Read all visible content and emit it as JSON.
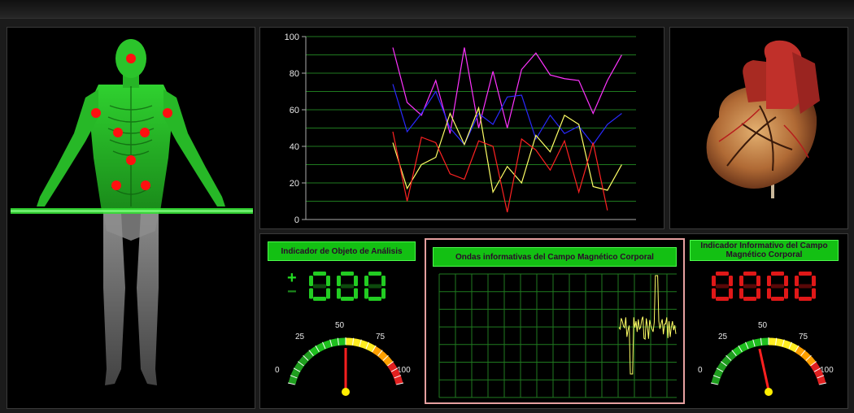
{
  "window": {
    "title_bar": ""
  },
  "chart_data": {
    "type": "line",
    "x": [
      1,
      2,
      3,
      4,
      5,
      6,
      7,
      8,
      9,
      10,
      11,
      12,
      13,
      14,
      15,
      16,
      17,
      18
    ],
    "ylim": [
      0,
      100
    ],
    "yticks": [
      "0",
      "20",
      "40",
      "60",
      "80",
      "100"
    ],
    "grid": true,
    "legend": "none",
    "series": [
      {
        "color": "#ff33ff",
        "values": [
          94,
          64,
          57,
          76,
          47,
          94,
          50,
          81,
          50,
          82,
          91,
          79,
          77,
          76,
          58,
          76,
          90,
          null
        ]
      },
      {
        "color": "#2a2aff",
        "values": [
          74,
          48,
          58,
          70,
          50,
          41,
          58,
          52,
          67,
          68,
          44,
          57,
          47,
          51,
          41,
          52,
          58,
          null
        ]
      },
      {
        "color": "#ffff66",
        "values": [
          42,
          17,
          30,
          34,
          58,
          41,
          61,
          15,
          29,
          20,
          46,
          37,
          57,
          52,
          18,
          16,
          30,
          null
        ]
      },
      {
        "color": "#ff2222",
        "values": [
          48,
          10,
          45,
          42,
          25,
          22,
          43,
          40,
          4,
          44,
          38,
          27,
          43,
          15,
          42,
          5,
          null,
          null
        ]
      }
    ]
  },
  "analysis_indicator": {
    "title": "Indicador de Objeto de Análisis",
    "plus": "+",
    "minus": "−",
    "digits": "888",
    "gauge": {
      "min": "0",
      "t25": "25",
      "t50": "50",
      "t75": "75",
      "max": "100",
      "value": 50
    }
  },
  "wave_panel": {
    "title": "Ondas informativas del Campo Magnético Corporal"
  },
  "info_indicator": {
    "title": "Indicador Informativo del Campo Magnético Corporal",
    "digits": "8888",
    "gauge": {
      "min": "0",
      "t25": "25",
      "t50": "50",
      "t75": "75",
      "max": "100",
      "value": 43
    }
  },
  "colors": {
    "lcd_green": "#22ff22",
    "lcd_red": "#ff2020",
    "label_green": "#13c013",
    "grid_green": "#1f7a1f",
    "point_red": "#ff1010"
  },
  "icons": {
    "body": "human-body-scan-icon",
    "heart": "anatomical-heart-icon"
  }
}
